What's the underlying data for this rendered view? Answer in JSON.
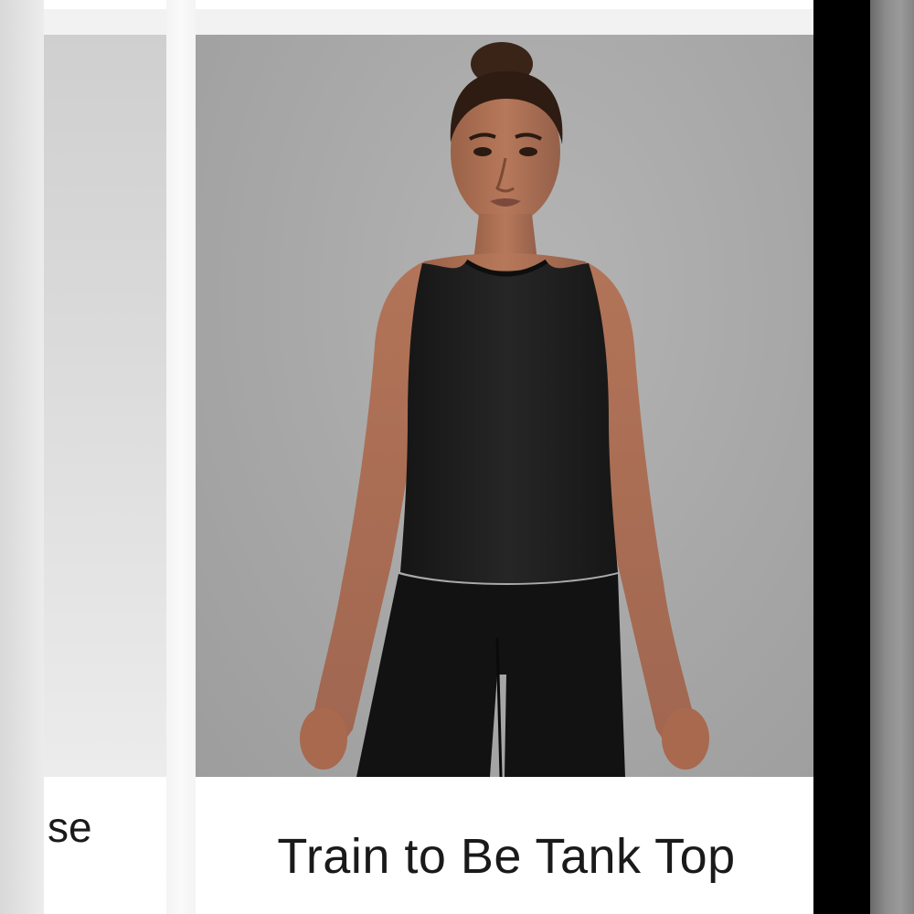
{
  "products": [
    {
      "title": "se",
      "image": "product-photo-partial"
    },
    {
      "title": "Train to Be Tank Top",
      "image": "model-wearing-black-tank-top"
    }
  ],
  "colors": {
    "page_background": "#f2f2f2",
    "card_background": "#ffffff",
    "photo_backdrop": "#a8a8a8",
    "title_text": "#1a1a1a",
    "tank_top": "#1c1c1c",
    "right_edge": "#000000"
  }
}
